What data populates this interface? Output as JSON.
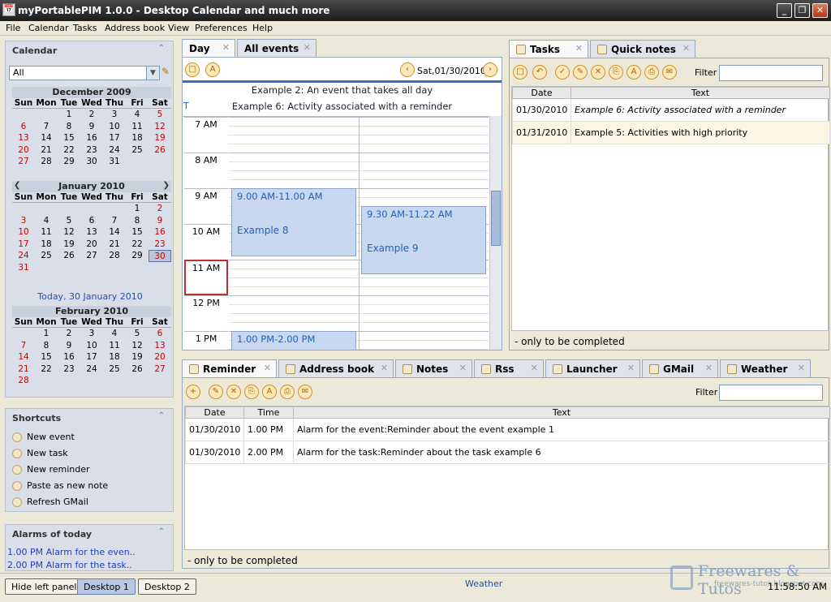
{
  "window": {
    "title": "myPortablePIM 1.0.0 - Desktop Calendar and much more",
    "app_icon": "calendar-icon",
    "min": "_",
    "max": "❐",
    "close": "✕"
  },
  "menu": [
    "File",
    "Calendar",
    "Tasks",
    "Address book",
    "View",
    "Preferences",
    "Help"
  ],
  "calendar_panel": {
    "title": "Calendar",
    "filter_value": "All",
    "dow": [
      "Sun",
      "Mon",
      "Tue",
      "Wed",
      "Thu",
      "Fri",
      "Sat"
    ],
    "dec": {
      "title": "December 2009",
      "days": [
        "",
        "",
        "1",
        "2",
        "3",
        "4",
        "5",
        "6",
        "7",
        "8",
        "9",
        "10",
        "11",
        "12",
        "13",
        "14",
        "15",
        "16",
        "17",
        "18",
        "19",
        "20",
        "21",
        "22",
        "23",
        "24",
        "25",
        "26",
        "27",
        "28",
        "29",
        "30",
        "31",
        "",
        ""
      ]
    },
    "jan": {
      "title": "January 2010",
      "days": [
        "",
        "",
        "",
        "",
        "",
        "1",
        "2",
        "3",
        "4",
        "5",
        "6",
        "7",
        "8",
        "9",
        "10",
        "11",
        "12",
        "13",
        "14",
        "15",
        "16",
        "17",
        "18",
        "19",
        "20",
        "21",
        "22",
        "23",
        "24",
        "25",
        "26",
        "27",
        "28",
        "29",
        "30",
        "31"
      ]
    },
    "today": "Today, 30 January 2010",
    "feb": {
      "title": "February 2010",
      "days": [
        "",
        "1",
        "2",
        "3",
        "4",
        "5",
        "6",
        "7",
        "8",
        "9",
        "10",
        "11",
        "12",
        "13",
        "14",
        "15",
        "16",
        "17",
        "18",
        "19",
        "20",
        "21",
        "22",
        "23",
        "24",
        "25",
        "26",
        "27",
        "28"
      ]
    }
  },
  "shortcuts": {
    "title": "Shortcuts",
    "items": [
      "New event",
      "New task",
      "New reminder",
      "Paste as new note",
      "Refresh GMail"
    ]
  },
  "alarms": {
    "title": "Alarms of today",
    "items": [
      "1.00 PM Alarm for the even..",
      "2.00 PM Alarm for the task.."
    ]
  },
  "day_view": {
    "tabs": [
      "Day",
      "All events"
    ],
    "date": "Sat,01/30/2010",
    "allday": "Example 2: An event that takes all day",
    "reminder_marker": "T",
    "reminder": "Example 6: Activity associated with a reminder",
    "hours": [
      "7 AM",
      "8 AM",
      "9 AM",
      "10 AM",
      "11 AM",
      "12 PM",
      "1 PM"
    ],
    "events": [
      {
        "time": "9.00 AM-11.00 AM",
        "name": "Example 8"
      },
      {
        "time": "9.30 AM-11.22 AM",
        "name": "Example 9"
      },
      {
        "time": "1.00 PM-2.00 PM",
        "name": ""
      }
    ]
  },
  "tasks": {
    "tabs": [
      "Tasks",
      "Quick notes"
    ],
    "filter_label": "Filter",
    "columns": [
      "Date",
      "Text"
    ],
    "rows": [
      {
        "date": "01/30/2010",
        "text": "Example 6: Activity associated with a reminder"
      },
      {
        "date": "01/31/2010",
        "text": "Example 5: Activities with high priority"
      }
    ],
    "footer": "- only to be completed"
  },
  "bottom": {
    "tabs": [
      "Reminder",
      "Address book",
      "Notes",
      "Rss",
      "Launcher",
      "GMail",
      "Weather"
    ],
    "filter_label": "Filter",
    "columns": [
      "Date",
      "Time",
      "Text"
    ],
    "rows": [
      {
        "date": "01/30/2010",
        "time": "1.00 PM",
        "text": "Alarm for the event:Reminder about the event example 1"
      },
      {
        "date": "01/30/2010",
        "time": "2.00 PM",
        "text": "Alarm for the task:Reminder about the task example 6"
      }
    ],
    "footer": "- only to be completed"
  },
  "status": {
    "hide_left": "Hide left panel",
    "desktop1": "Desktop 1",
    "desktop2": "Desktop 2",
    "weather": "Weather",
    "clock": "11:58:50 AM",
    "watermark_title": "Freewares & Tutos",
    "watermark_url": "freewares-tutos.blogspot.com"
  }
}
